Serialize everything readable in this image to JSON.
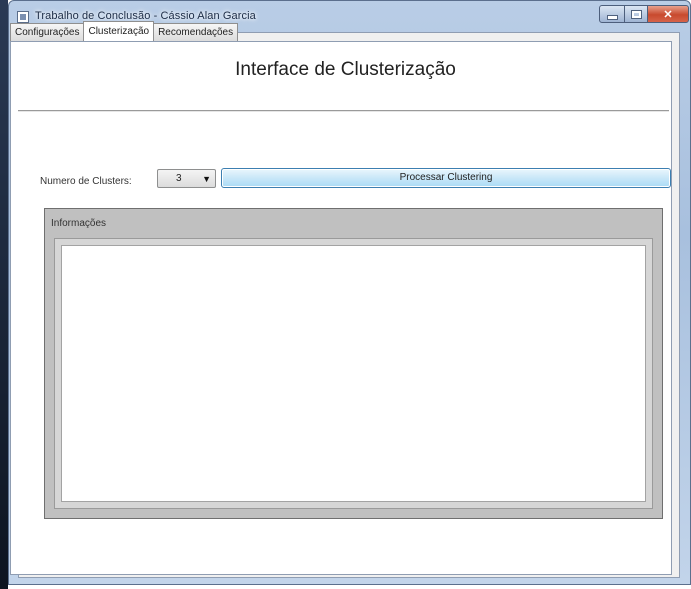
{
  "window": {
    "title": "Trabalho de Conclusão - Cássio Alan Garcia"
  },
  "tabs": [
    {
      "label": "Configurações",
      "active": false
    },
    {
      "label": "Clusterização",
      "active": true
    },
    {
      "label": "Recomendações",
      "active": false
    }
  ],
  "main": {
    "heading": "Interface de Clusterização",
    "clusters_label": "Numero de Clusters:",
    "clusters_value": "3",
    "process_button": "Processar Clustering",
    "info_label": "Informações"
  },
  "icons": {
    "app": "window-app-icon",
    "minimize": "minimize-icon",
    "maximize": "maximize-icon",
    "close": "close-icon",
    "dropdown": "chevron-down-icon"
  },
  "colors": {
    "close_button": "#c84a2e",
    "process_button": "#a9dbf6",
    "group_background": "#c0c0c0"
  }
}
